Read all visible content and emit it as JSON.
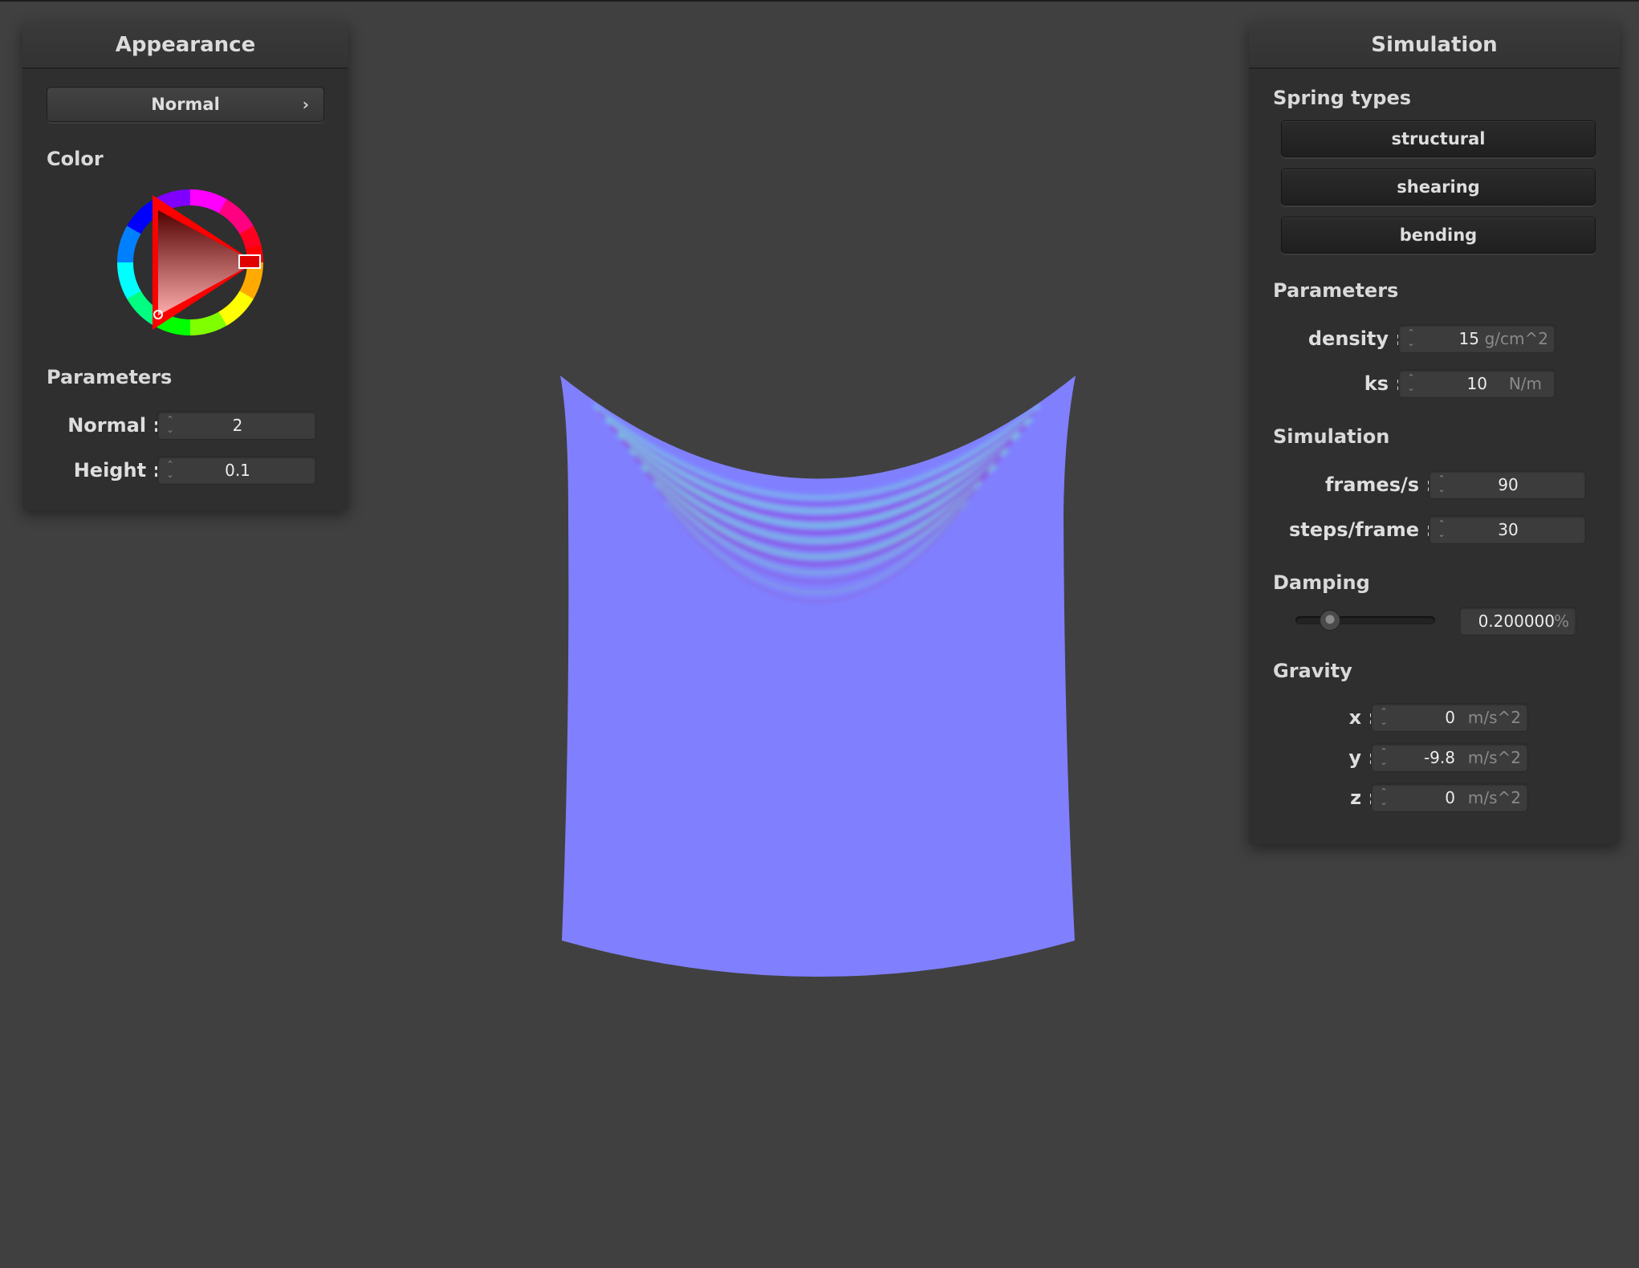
{
  "appearance": {
    "title": "Appearance",
    "shader_select": "Normal",
    "color_label": "Color",
    "selected_color": "#ff0000",
    "parameters_label": "Parameters",
    "normal": {
      "label": "Normal :",
      "value": "2"
    },
    "height": {
      "label": "Height :",
      "value": "0.1"
    }
  },
  "simulation": {
    "title": "Simulation",
    "spring_types_label": "Spring types",
    "spring_types": [
      "structural",
      "shearing",
      "bending"
    ],
    "parameters_label": "Parameters",
    "density": {
      "label": "density :",
      "value": "15",
      "unit": "g/cm^2"
    },
    "ks": {
      "label": "ks :",
      "value": "10",
      "unit": "N/m"
    },
    "simulation_label": "Simulation",
    "fps": {
      "label": "frames/s :",
      "value": "90"
    },
    "steps": {
      "label": "steps/frame :",
      "value": "30"
    },
    "damping_label": "Damping",
    "damping": {
      "value": "0.200000",
      "unit": "%",
      "level": 0.2
    },
    "gravity_label": "Gravity",
    "gravity": [
      {
        "label": "x :",
        "value": "0",
        "unit": "m/s^2"
      },
      {
        "label": "y :",
        "value": "-9.8",
        "unit": "m/s^2"
      },
      {
        "label": "z :",
        "value": "0",
        "unit": "m/s^2"
      }
    ]
  },
  "colors": {
    "background": "#404040",
    "cloth": "#8080ff"
  }
}
